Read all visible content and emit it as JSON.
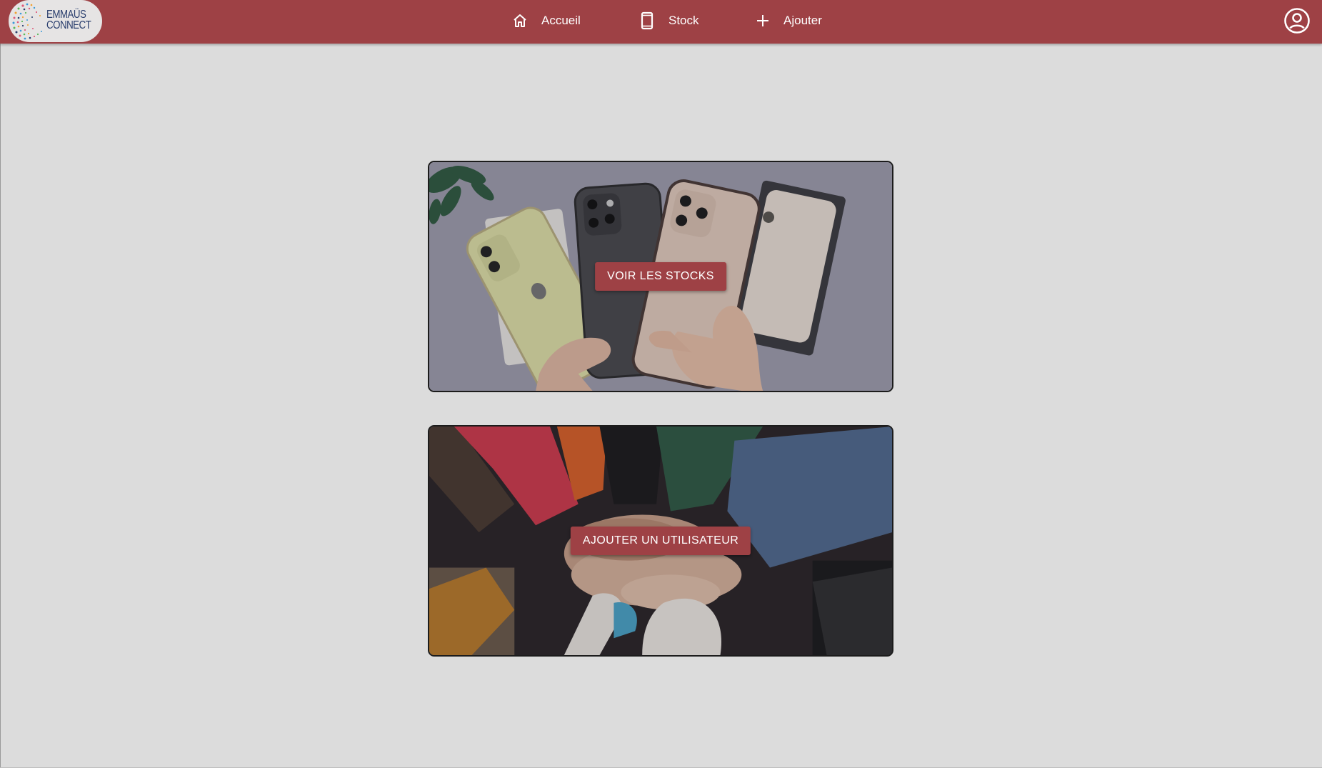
{
  "brand": {
    "logo_line1": "EMMAÜS",
    "logo_line2": "CONNECT",
    "color_primary": "#9e4145",
    "color_background": "#dcdcdc"
  },
  "nav": {
    "items": [
      {
        "label": "Accueil",
        "icon": "home-icon"
      },
      {
        "label": "Stock",
        "icon": "smartphone-icon"
      },
      {
        "label": "Ajouter",
        "icon": "plus-icon"
      }
    ],
    "account_icon": "account-circle-icon"
  },
  "cards": [
    {
      "button_label": "VOIR LES STOCKS",
      "image": "smartphones-in-hands-photo"
    },
    {
      "button_label": "AJOUTER UN UTILISATEUR",
      "image": "stacked-hands-photo"
    }
  ]
}
